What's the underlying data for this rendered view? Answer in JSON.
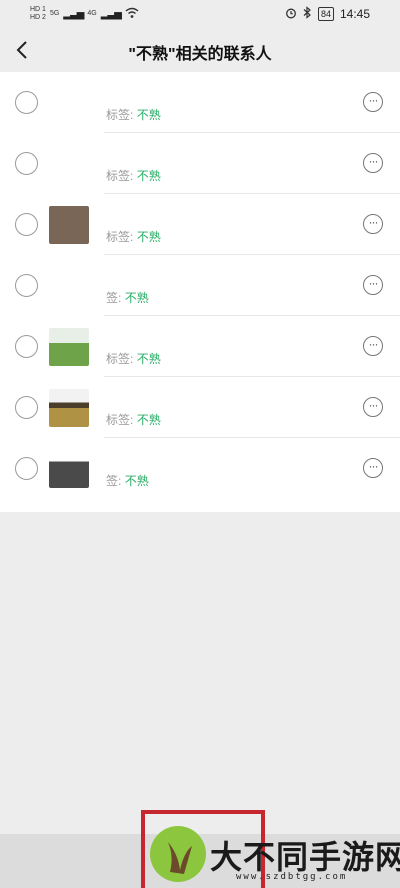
{
  "status_bar": {
    "sim1": "HD 1",
    "sim2": "HD 2",
    "network_1": "5G",
    "network_2": "4G",
    "battery": "84",
    "time": "14:45",
    "icons": [
      "signal-icon",
      "wifi-icon",
      "alarm-icon",
      "bluetooth-icon",
      "battery-icon"
    ]
  },
  "header": {
    "back_icon": "chevron-left-icon",
    "title": "\"不熟\"相关的联系人"
  },
  "contacts": [
    {
      "tag_label": "标签:",
      "tag_value": "不熟",
      "avatar_color": "#ffffff"
    },
    {
      "tag_label": "标签:",
      "tag_value": "不熟",
      "avatar_color": "#ffffff"
    },
    {
      "tag_label": "标签:",
      "tag_value": "不熟",
      "avatar_color": "#7a6656"
    },
    {
      "tag_label": "签:",
      "tag_value": "不熟",
      "avatar_color": "#ffffff"
    },
    {
      "tag_label": "标签:",
      "tag_value": "不熟",
      "avatar_color": "#6fa34a"
    },
    {
      "tag_label": "标签:",
      "tag_value": "不熟",
      "avatar_color": "#b09245"
    },
    {
      "tag_label": "签:",
      "tag_value": "不熟",
      "avatar_color": "#4a4a4a"
    }
  ],
  "watermark": {
    "main": "大不同手游网",
    "sub": "www.szdbtgg.com"
  },
  "colors": {
    "tag_green": "#2aae67",
    "background": "#ededed",
    "frame_red": "#c6262d"
  }
}
